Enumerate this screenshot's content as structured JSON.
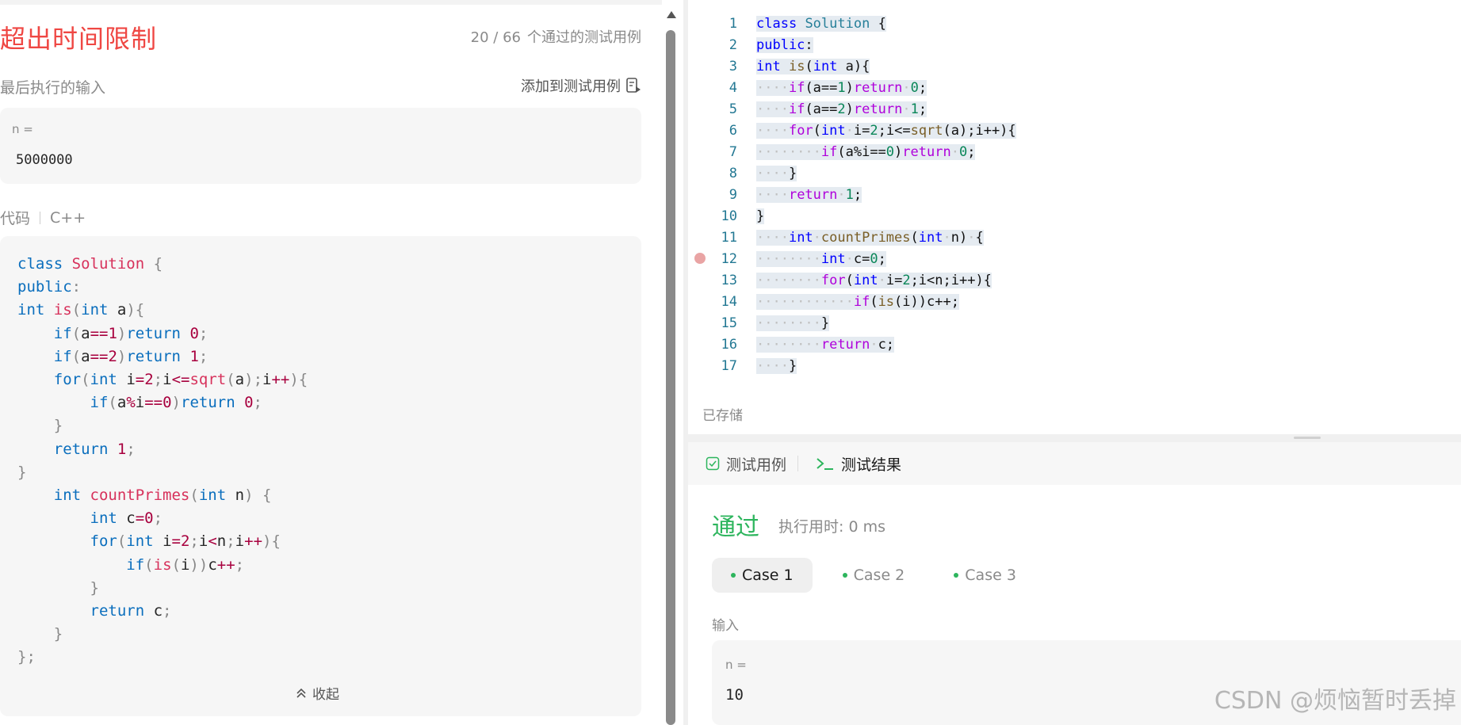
{
  "left": {
    "status_title": "超出时间限制",
    "passed_num": "20 / 66",
    "passed_text": "个通过的测试用例",
    "last_input_label": "最后执行的输入",
    "add_testcase_label": "添加到测试用例",
    "input_var": "n =",
    "input_value": "5000000",
    "code_label": "代码",
    "code_lang": "C++",
    "collapse_label": "收起"
  },
  "editor": {
    "line_numbers": [
      "1",
      "2",
      "3",
      "4",
      "5",
      "6",
      "7",
      "8",
      "9",
      "10",
      "11",
      "12",
      "13",
      "14",
      "15",
      "16",
      "17"
    ],
    "saved_label": "已存储"
  },
  "results": {
    "tab_testcase": "测试用例",
    "tab_result": "测试结果",
    "pass_title": "通过",
    "runtime_label": "执行用时: 0 ms",
    "cases": [
      "Case 1",
      "Case 2",
      "Case 3"
    ],
    "input_label": "输入",
    "input_var": "n =",
    "input_value": "10"
  },
  "watermark": "CSDN @烦恼暂时丢掉",
  "colors": {
    "error_red": "#ef4743",
    "pass_green": "#2db55d",
    "keyword_blue": "#0a6ebd"
  }
}
